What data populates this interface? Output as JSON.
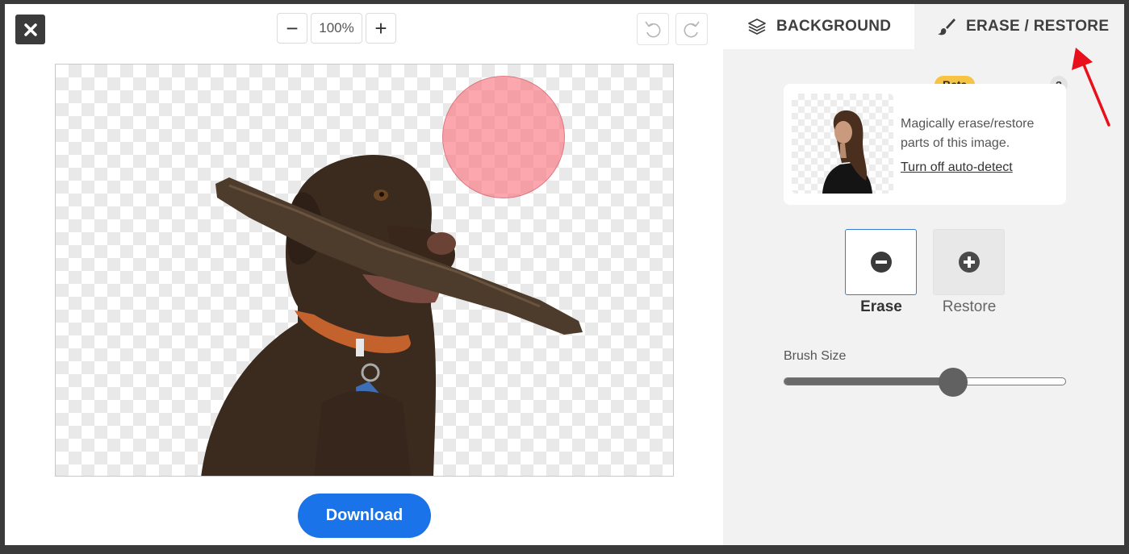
{
  "toolbar": {
    "zoom_out_symbol": "−",
    "zoom_value": "100%",
    "zoom_in_symbol": "+"
  },
  "download_button": {
    "label": "Download"
  },
  "tabs": [
    {
      "label": "BACKGROUND",
      "icon": "layers-icon",
      "active": false
    },
    {
      "label": "ERASE / RESTORE",
      "icon": "brush-icon",
      "active": true
    }
  ],
  "info_card": {
    "badge": "Beta",
    "help": "?",
    "description": "Magically erase/restore parts of this image.",
    "link": "Turn off auto-detect"
  },
  "modes": [
    {
      "label": "Erase",
      "icon": "minus-circle-icon",
      "selected": true
    },
    {
      "label": "Restore",
      "icon": "plus-circle-icon",
      "selected": false
    }
  ],
  "brush": {
    "label": "Brush Size",
    "value": 0.6
  },
  "colors": {
    "accent": "#1a73e8",
    "brush_preview": "#f87882",
    "beta_badge": "#f6c343",
    "annotation_arrow": "#e8101a"
  }
}
